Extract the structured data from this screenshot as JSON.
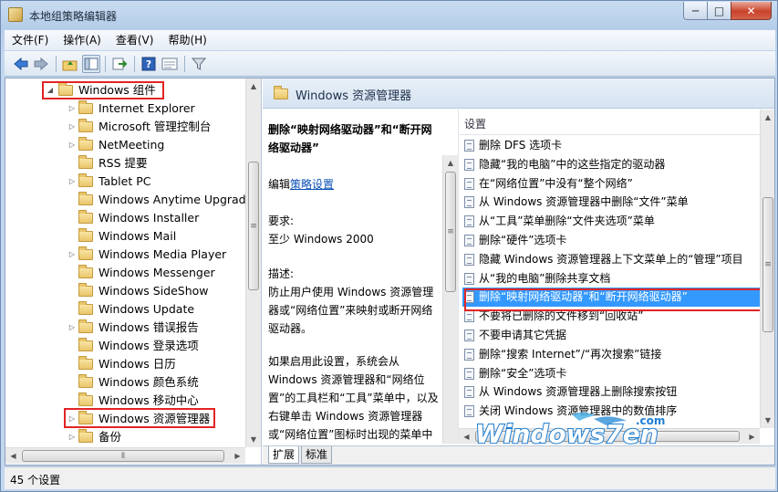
{
  "window": {
    "title": "本地组策略编辑器"
  },
  "controls": {
    "minimize": "─",
    "maximize": "□",
    "close": "✕"
  },
  "menu": [
    "文件(F)",
    "操作(A)",
    "查看(V)",
    "帮助(H)"
  ],
  "toolbar_icons": [
    "back-icon",
    "forward-icon",
    "up-folder-icon",
    "show-hide-tree-icon",
    "export-list-icon",
    "help-icon",
    "properties-icon",
    "filter-icon"
  ],
  "tree": {
    "items": [
      {
        "label": "Windows 组件",
        "expander": "◢",
        "highlighted": true
      },
      {
        "label": "Internet Explorer",
        "expander": "▷"
      },
      {
        "label": "Microsoft 管理控制台",
        "expander": "▷"
      },
      {
        "label": "NetMeeting",
        "expander": "▷"
      },
      {
        "label": "RSS 提要",
        "expander": ""
      },
      {
        "label": "Tablet PC",
        "expander": "▷"
      },
      {
        "label": "Windows Anytime Upgrade",
        "expander": ""
      },
      {
        "label": "Windows Installer",
        "expander": ""
      },
      {
        "label": "Windows Mail",
        "expander": ""
      },
      {
        "label": "Windows Media Player",
        "expander": "▷"
      },
      {
        "label": "Windows Messenger",
        "expander": ""
      },
      {
        "label": "Windows SideShow",
        "expander": ""
      },
      {
        "label": "Windows Update",
        "expander": ""
      },
      {
        "label": "Windows 错误报告",
        "expander": "▷"
      },
      {
        "label": "Windows 登录选项",
        "expander": ""
      },
      {
        "label": "Windows 日历",
        "expander": ""
      },
      {
        "label": "Windows 颜色系统",
        "expander": ""
      },
      {
        "label": "Windows 移动中心",
        "expander": ""
      },
      {
        "label": "Windows 资源管理器",
        "expander": "▷",
        "highlighted": true
      },
      {
        "label": "备份",
        "expander": "▷"
      }
    ]
  },
  "pane": {
    "title": "Windows 资源管理器",
    "description": {
      "heading": "删除“映射网络驱动器”和“断开网络驱动器”",
      "edit_prefix": "编辑",
      "edit_link": "策略设置",
      "requirements_label": "要求:",
      "requirements_value": "至少 Windows 2000",
      "description_label": "描述:",
      "description_p1": "防止用户使用 Windows 资源管理器或“网络位置”来映射或断开网络驱动器。",
      "description_p2": "如果启用此设置，系统会从 Windows 资源管理器和“网络位置”的工具栏和“工具”菜单中，以及右键单击 Windows 资源管理器或“网络位置”图标时出现的菜单中删除“映射网络驱动器”和"
    },
    "column_header": "设置",
    "settings": [
      "删除 DFS 选项卡",
      "隐藏“我的电脑”中的这些指定的驱动器",
      "在“网络位置”中没有“整个网络”",
      "从 Windows 资源管理器中删除“文件”菜单",
      "从“工具”菜单删除“文件夹选项”菜单",
      "删除“硬件”选项卡",
      "隐藏 Windows 资源管理器上下文菜单上的“管理”项目",
      "从“我的电脑”删除共享文档",
      "删除“映射网络驱动器”和“断开网络驱动器”",
      "不要将已删除的文件移到“回收站”",
      "不要申请其它凭据",
      "删除“搜索 Internet”/“再次搜索”链接",
      "删除“安全”选项卡",
      "从 Windows 资源管理器上删除搜索按钮",
      "关闭 Windows 资源管理器中的数值排序"
    ],
    "selected_index": 8,
    "tabs": [
      "扩展",
      "标准"
    ]
  },
  "status": "45 个设置",
  "watermark": {
    "text": "Windows7en",
    "suffix": ".com"
  },
  "colors": {
    "selection": "#3399ff",
    "highlight_box": "#e12424",
    "link": "#0a4fb4"
  }
}
